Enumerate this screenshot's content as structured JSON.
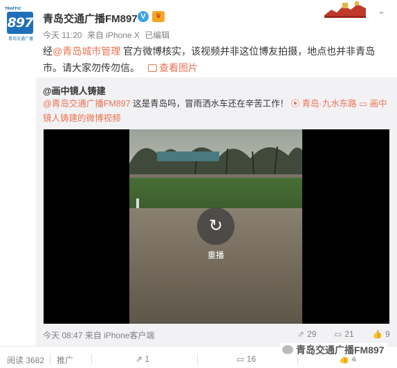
{
  "header": {
    "avatar_tag": "TRAFFIC",
    "avatar_logo": "897",
    "avatar_sub": "青岛交通广播",
    "name": "青岛交通广播FM897",
    "verified": "V",
    "member": "♛",
    "chevron": "⌄"
  },
  "meta": {
    "time": "今天 11:20",
    "source": "来自 iPhone X",
    "edited": "已编辑"
  },
  "post": {
    "prefix": "经",
    "mention": "@青岛城市管理",
    "body": " 官方微博核实，该视频并非这位博友拍摄，地点也并非青岛市。请大家勿传勿信。",
    "pic_link": "查看图片"
  },
  "repost": {
    "author": "@画中镜人铸建",
    "mention": "@青岛交通广播FM897",
    "text": " 这是青岛吗，冒雨洒水车还在辛苦工作！",
    "location": "青岛·九水东路",
    "video_link": "画中镜人铸建的微博视频",
    "replay_label": "重播",
    "time": "今天 08:47",
    "source": "来自 iPhone客户端",
    "forwards": "29",
    "comments": "21",
    "likes": "9"
  },
  "bottom": {
    "views": "阅读 3682",
    "promote": "推广",
    "forwards": "1",
    "comments": "16",
    "likes": "4"
  },
  "watermark": "青岛交通广播FM897",
  "colors": {
    "link": "#eb7350",
    "brand": "#1e6fb8",
    "repost_bg": "#f2f2f5"
  }
}
